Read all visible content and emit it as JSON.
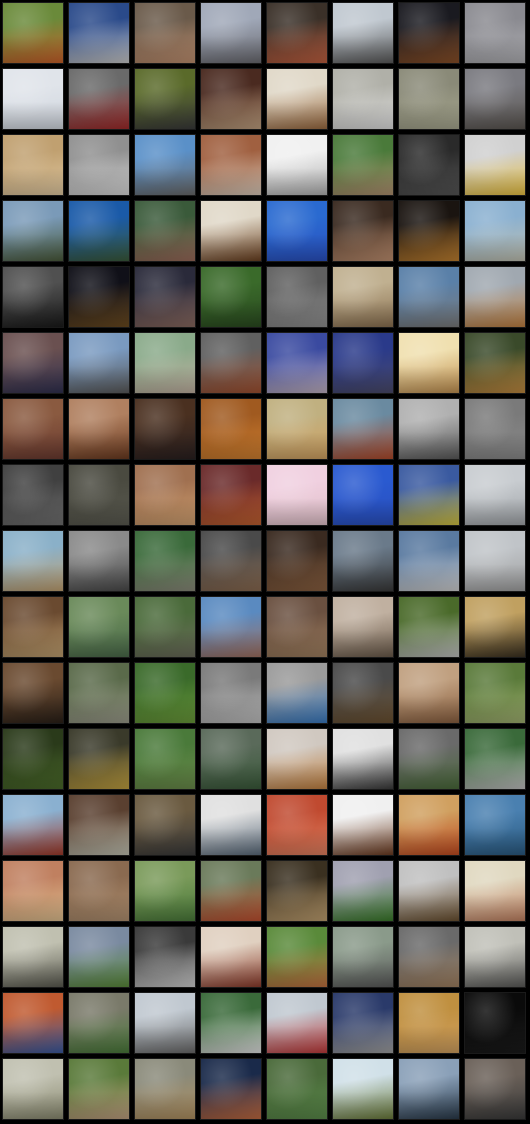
{
  "grid": {
    "columns": 8,
    "rows": 17,
    "tiles": [
      {
        "top": "#6a8a3a",
        "bottom": "#c8602a"
      },
      {
        "top": "#2a4a8a",
        "bottom": "#c8c8c8"
      },
      {
        "top": "#6a5a4a",
        "bottom": "#c09070"
      },
      {
        "top": "#a0a8b8",
        "bottom": "#6a6a70"
      },
      {
        "top": "#3a3028",
        "bottom": "#c06040"
      },
      {
        "top": "#c0c8d0",
        "bottom": "#5a5a5a"
      },
      {
        "top": "#1a1a20",
        "bottom": "#8a5028"
      },
      {
        "top": "#8a8a90",
        "bottom": "#b0b0b4"
      },
      {
        "top": "#e0e4ea",
        "bottom": "#d0d6de"
      },
      {
        "top": "#6a6a6a",
        "bottom": "#a02a2a"
      },
      {
        "top": "#5a6a2a",
        "bottom": "#3a3a3a"
      },
      {
        "top": "#4a2a20",
        "bottom": "#c0a080"
      },
      {
        "top": "#e0d8c8",
        "bottom": "#9a6a40"
      },
      {
        "top": "#b0b0a8",
        "bottom": "#e0e0e0"
      },
      {
        "top": "#8a8a78",
        "bottom": "#a8a890"
      },
      {
        "top": "#7a7a80",
        "bottom": "#5a5550"
      },
      {
        "top": "#c0a070",
        "bottom": "#e0c8a0"
      },
      {
        "top": "#909090",
        "bottom": "#d8d8d8"
      },
      {
        "top": "#5a90c8",
        "bottom": "#6a6a6a"
      },
      {
        "top": "#a06040",
        "bottom": "#d8c8b8"
      },
      {
        "top": "#f0f0f0",
        "bottom": "#b0b0b0"
      },
      {
        "top": "#4a7a3a",
        "bottom": "#b09070"
      },
      {
        "top": "#2a2a2a",
        "bottom": "#555555"
      },
      {
        "top": "#d0d0d0",
        "bottom": "#e8c040"
      },
      {
        "top": "#7a9ab8",
        "bottom": "#4a5a3a"
      },
      {
        "top": "#1a5aa8",
        "bottom": "#3a5a3a"
      },
      {
        "top": "#3a5a3a",
        "bottom": "#9a6a5a"
      },
      {
        "top": "#e0d8c8",
        "bottom": "#6a4020"
      },
      {
        "top": "#2a6ad0",
        "bottom": "#2a50c0"
      },
      {
        "top": "#3a2a20",
        "bottom": "#c09070"
      },
      {
        "top": "#1a1410",
        "bottom": "#c08030"
      },
      {
        "top": "#8ab0d0",
        "bottom": "#c0c0b0"
      },
      {
        "top": "#505050",
        "bottom": "#1a1a1a"
      },
      {
        "top": "#101018",
        "bottom": "#6a4a20"
      },
      {
        "top": "#2a2a3a",
        "bottom": "#8a6a60"
      },
      {
        "top": "#3a6a2a",
        "bottom": "#2a4a20"
      },
      {
        "top": "#606060",
        "bottom": "#909090"
      },
      {
        "top": "#c0b090",
        "bottom": "#8a7050"
      },
      {
        "top": "#5a80a8",
        "bottom": "#7a7a7a"
      },
      {
        "top": "#a0a8b0",
        "bottom": "#c08040"
      },
      {
        "top": "#6a5050",
        "bottom": "#303050"
      },
      {
        "top": "#7a9ac0",
        "bottom": "#5a5a5a"
      },
      {
        "top": "#8aaa8a",
        "bottom": "#c0b0a0"
      },
      {
        "top": "#606060",
        "bottom": "#a05030"
      },
      {
        "top": "#3a4aa0",
        "bottom": "#c0b0c0"
      },
      {
        "top": "#2a3a8a",
        "bottom": "#4a4a6a"
      },
      {
        "top": "#f0e0b0",
        "bottom": "#c09050"
      },
      {
        "top": "#3a4a2a",
        "bottom": "#c08a40"
      },
      {
        "top": "#8a5a40",
        "bottom": "#6a3a30"
      },
      {
        "top": "#b08060",
        "bottom": "#6a3a20"
      },
      {
        "top": "#4a3020",
        "bottom": "#2a2020"
      },
      {
        "top": "#a05a20",
        "bottom": "#d08030"
      },
      {
        "top": "#c0b080",
        "bottom": "#d0a060"
      },
      {
        "top": "#6a8aa0",
        "bottom": "#b04a2a"
      },
      {
        "top": "#b0b0b0",
        "bottom": "#5a5a5a"
      },
      {
        "top": "#7a7a7a",
        "bottom": "#8a8a8a"
      },
      {
        "top": "#404040",
        "bottom": "#707070"
      },
      {
        "top": "#4a4a40",
        "bottom": "#5a5a50"
      },
      {
        "top": "#a07050",
        "bottom": "#d0a070"
      },
      {
        "top": "#6a2a2a",
        "bottom": "#c06030"
      },
      {
        "top": "#f0d0e0",
        "bottom": "#e0c0c8"
      },
      {
        "top": "#2a5ad0",
        "bottom": "#2a50c0"
      },
      {
        "top": "#3a5aa0",
        "bottom": "#d0c040"
      },
      {
        "top": "#c8ccd0",
        "bottom": "#a0a4a8"
      },
      {
        "top": "#8ab0c8",
        "bottom": "#c0a070"
      },
      {
        "top": "#8a8a8a",
        "bottom": "#4a4a4a"
      },
      {
        "top": "#3a6a3a",
        "bottom": "#8a8a7a"
      },
      {
        "top": "#4a4a4a",
        "bottom": "#8a6a50"
      },
      {
        "top": "#3a2a20",
        "bottom": "#8a6040"
      },
      {
        "top": "#6a7a8a",
        "bottom": "#3a3a3a"
      },
      {
        "top": "#5a7aa0",
        "bottom": "#d0d0d0"
      },
      {
        "top": "#c0c4c8",
        "bottom": "#a0a0a0"
      },
      {
        "top": "#6a4a30",
        "bottom": "#c0a070"
      },
      {
        "top": "#6a8a5a",
        "bottom": "#4a6a4a"
      },
      {
        "top": "#4a6a3a",
        "bottom": "#6a6a5a"
      },
      {
        "top": "#5a8ac0",
        "bottom": "#a07060"
      },
      {
        "top": "#6a5040",
        "bottom": "#a08060"
      },
      {
        "top": "#c0b0a0",
        "bottom": "#6a5a4a"
      },
      {
        "top": "#4a6a2a",
        "bottom": "#c0c0c0"
      },
      {
        "top": "#c0a060",
        "bottom": "#3a3020"
      },
      {
        "top": "#6a4a30",
        "bottom": "#2a2018"
      },
      {
        "top": "#5a6a4a",
        "bottom": "#9a9a8a"
      },
      {
        "top": "#3a6a2a",
        "bottom": "#6a9a3a"
      },
      {
        "top": "#7a7a7a",
        "bottom": "#c0c0c0"
      },
      {
        "top": "#9a9a9a",
        "bottom": "#3a7ac0"
      },
      {
        "top": "#4a4a4a",
        "bottom": "#6a5030"
      },
      {
        "top": "#c0a080",
        "bottom": "#8a6040"
      },
      {
        "top": "#5a7a3a",
        "bottom": "#a0b070"
      },
      {
        "top": "#2a3a1a",
        "bottom": "#4a6a2a"
      },
      {
        "top": "#3a3a2a",
        "bottom": "#c0a040"
      },
      {
        "top": "#4a7a3a",
        "bottom": "#6a8a4a"
      },
      {
        "top": "#5a6a5a",
        "bottom": "#3a5a3a"
      },
      {
        "top": "#d0c8c0",
        "bottom": "#c08040"
      },
      {
        "top": "#e0e0e0",
        "bottom": "#3a3a3a"
      },
      {
        "top": "#6a6a6a",
        "bottom": "#4a6a3a"
      },
      {
        "top": "#3a6a3a",
        "bottom": "#c0c0c0"
      },
      {
        "top": "#8ab0d0",
        "bottom": "#a03a2a"
      },
      {
        "top": "#5a4030",
        "bottom": "#c0c0b0"
      },
      {
        "top": "#6a5a40",
        "bottom": "#3a3a3a"
      },
      {
        "top": "#e0e0e0",
        "bottom": "#5a6a7a"
      },
      {
        "top": "#c04a30",
        "bottom": "#e08060"
      },
      {
        "top": "#f0f0f0",
        "bottom": "#6a3a20"
      },
      {
        "top": "#d0a060",
        "bottom": "#c04a20"
      },
      {
        "top": "#4a80b0",
        "bottom": "#2a5a80"
      },
      {
        "top": "#c08060",
        "bottom": "#e0c090"
      },
      {
        "top": "#8a6a50",
        "bottom": "#b09070"
      },
      {
        "top": "#7a9a5a",
        "bottom": "#4a7a3a"
      },
      {
        "top": "#6a7a5a",
        "bottom": "#c05030"
      },
      {
        "top": "#3a3020",
        "bottom": "#c0a070"
      },
      {
        "top": "#a0a0b0",
        "bottom": "#3a7a2a"
      },
      {
        "top": "#c0c0c0",
        "bottom": "#6a5030"
      },
      {
        "top": "#e0d8c0",
        "bottom": "#c08060"
      },
      {
        "top": "#c0c0b0",
        "bottom": "#5a5a50"
      },
      {
        "top": "#7a8aa0",
        "bottom": "#5a8a3a"
      },
      {
        "top": "#3a3a3a",
        "bottom": "#d0d0d0"
      },
      {
        "top": "#e0d0c0",
        "bottom": "#8a3a2a"
      },
      {
        "top": "#5a8a3a",
        "bottom": "#c07040"
      },
      {
        "top": "#8a9a8a",
        "bottom": "#5a5a5a"
      },
      {
        "top": "#6a6a6a",
        "bottom": "#a08060"
      },
      {
        "top": "#c0c0b8",
        "bottom": "#5a5a58"
      },
      {
        "top": "#c05a30",
        "bottom": "#3a5aa0"
      },
      {
        "top": "#7a7a6a",
        "bottom": "#4a7a3a"
      },
      {
        "top": "#c0c8d0",
        "bottom": "#6a6a6a"
      },
      {
        "top": "#3a6a3a",
        "bottom": "#e0e0e0"
      },
      {
        "top": "#c0c8d0",
        "bottom": "#c03a3a"
      },
      {
        "top": "#2a3a6a",
        "bottom": "#a0a0a0"
      },
      {
        "top": "#c09040",
        "bottom": "#d0a060"
      },
      {
        "top": "#0a0a0a",
        "bottom": "#1a1a1a"
      },
      {
        "top": "#c0c0b0",
        "bottom": "#8a8a70"
      },
      {
        "top": "#5a7a3a",
        "bottom": "#c0a080"
      },
      {
        "top": "#8a8a7a",
        "bottom": "#b09060"
      },
      {
        "top": "#1a2a4a",
        "bottom": "#c06a40"
      },
      {
        "top": "#4a6a3a",
        "bottom": "#5a8a4a"
      },
      {
        "top": "#d0e0e8",
        "bottom": "#6a7a3a"
      },
      {
        "top": "#8aa0b8",
        "bottom": "#2a3a4a"
      },
      {
        "top": "#6a6058",
        "bottom": "#3a3a3a"
      }
    ]
  }
}
